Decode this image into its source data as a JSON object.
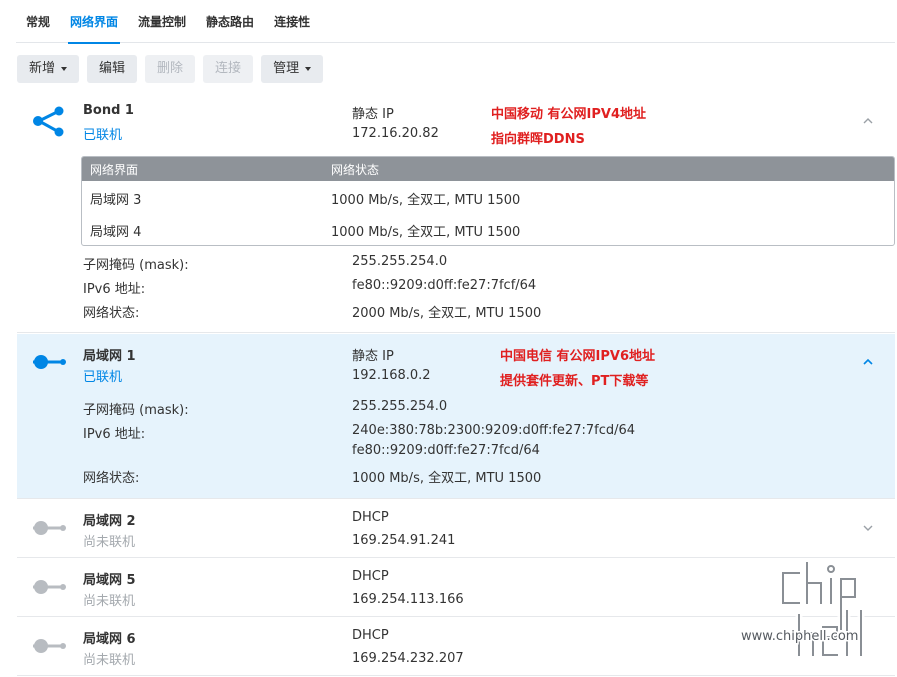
{
  "tabs": [
    "常规",
    "网络界面",
    "流量控制",
    "静态路由",
    "连接性"
  ],
  "toolbar": {
    "add": "新增",
    "edit": "编辑",
    "delete": "删除",
    "connect": "连接",
    "manage": "管理"
  },
  "colors": {
    "accent": "#0086e5",
    "connected": "#0086e5",
    "disconnected": "#a4a9ae",
    "annotation": "#e02020",
    "selected_bg": "#e6f3fc"
  },
  "labels": {
    "subnet_mask": "子网掩码 (mask):",
    "ipv6": "IPv6 地址:",
    "net_status": "网络状态:"
  },
  "bond1": {
    "icon": "share-network-icon",
    "name": "Bond 1",
    "status": "已联机",
    "mode": "静态 IP",
    "ip": "172.16.20.82",
    "annotation": [
      "中国移动  有公网IPV4地址",
      "指向群晖DDNS"
    ],
    "members_header": [
      "网络界面",
      "网络状态"
    ],
    "members": [
      {
        "iface": "局域网 3",
        "state": "1000 Mb/s, 全双工, MTU 1500"
      },
      {
        "iface": "局域网 4",
        "state": "1000 Mb/s, 全双工, MTU 1500"
      }
    ],
    "subnet_mask": "255.255.254.0",
    "ipv6": "fe80::9209:d0ff:fe27:7fcf/64",
    "net_status": "2000 Mb/s, 全双工, MTU 1500"
  },
  "lan1": {
    "icon": "ethernet-connected-icon",
    "name": "局域网 1",
    "status": "已联机",
    "mode": "静态 IP",
    "ip": "192.168.0.2",
    "annotation": [
      "中国电信 有公网IPV6地址",
      "提供套件更新、PT下载等"
    ],
    "subnet_mask": "255.255.254.0",
    "ipv6_1": "240e:380:78b:2300:9209:d0ff:fe27:7fcd/64",
    "ipv6_2": "fe80::9209:d0ff:fe27:7fcd/64",
    "net_status": "1000 Mb/s, 全双工, MTU 1500"
  },
  "lan2": {
    "icon": "ethernet-disconnected-icon",
    "name": "局域网 2",
    "status": "尚未联机",
    "mode": "DHCP",
    "ip": "169.254.91.241"
  },
  "lan5": {
    "icon": "ethernet-disconnected-icon",
    "name": "局域网 5",
    "status": "尚未联机",
    "mode": "DHCP",
    "ip": "169.254.113.166"
  },
  "lan6": {
    "icon": "ethernet-disconnected-icon",
    "name": "局域网 6",
    "status": "尚未联机",
    "mode": "DHCP",
    "ip": "169.254.232.207"
  },
  "watermark": {
    "logo_text": "chip hell",
    "url": "www.chiphell.com"
  }
}
